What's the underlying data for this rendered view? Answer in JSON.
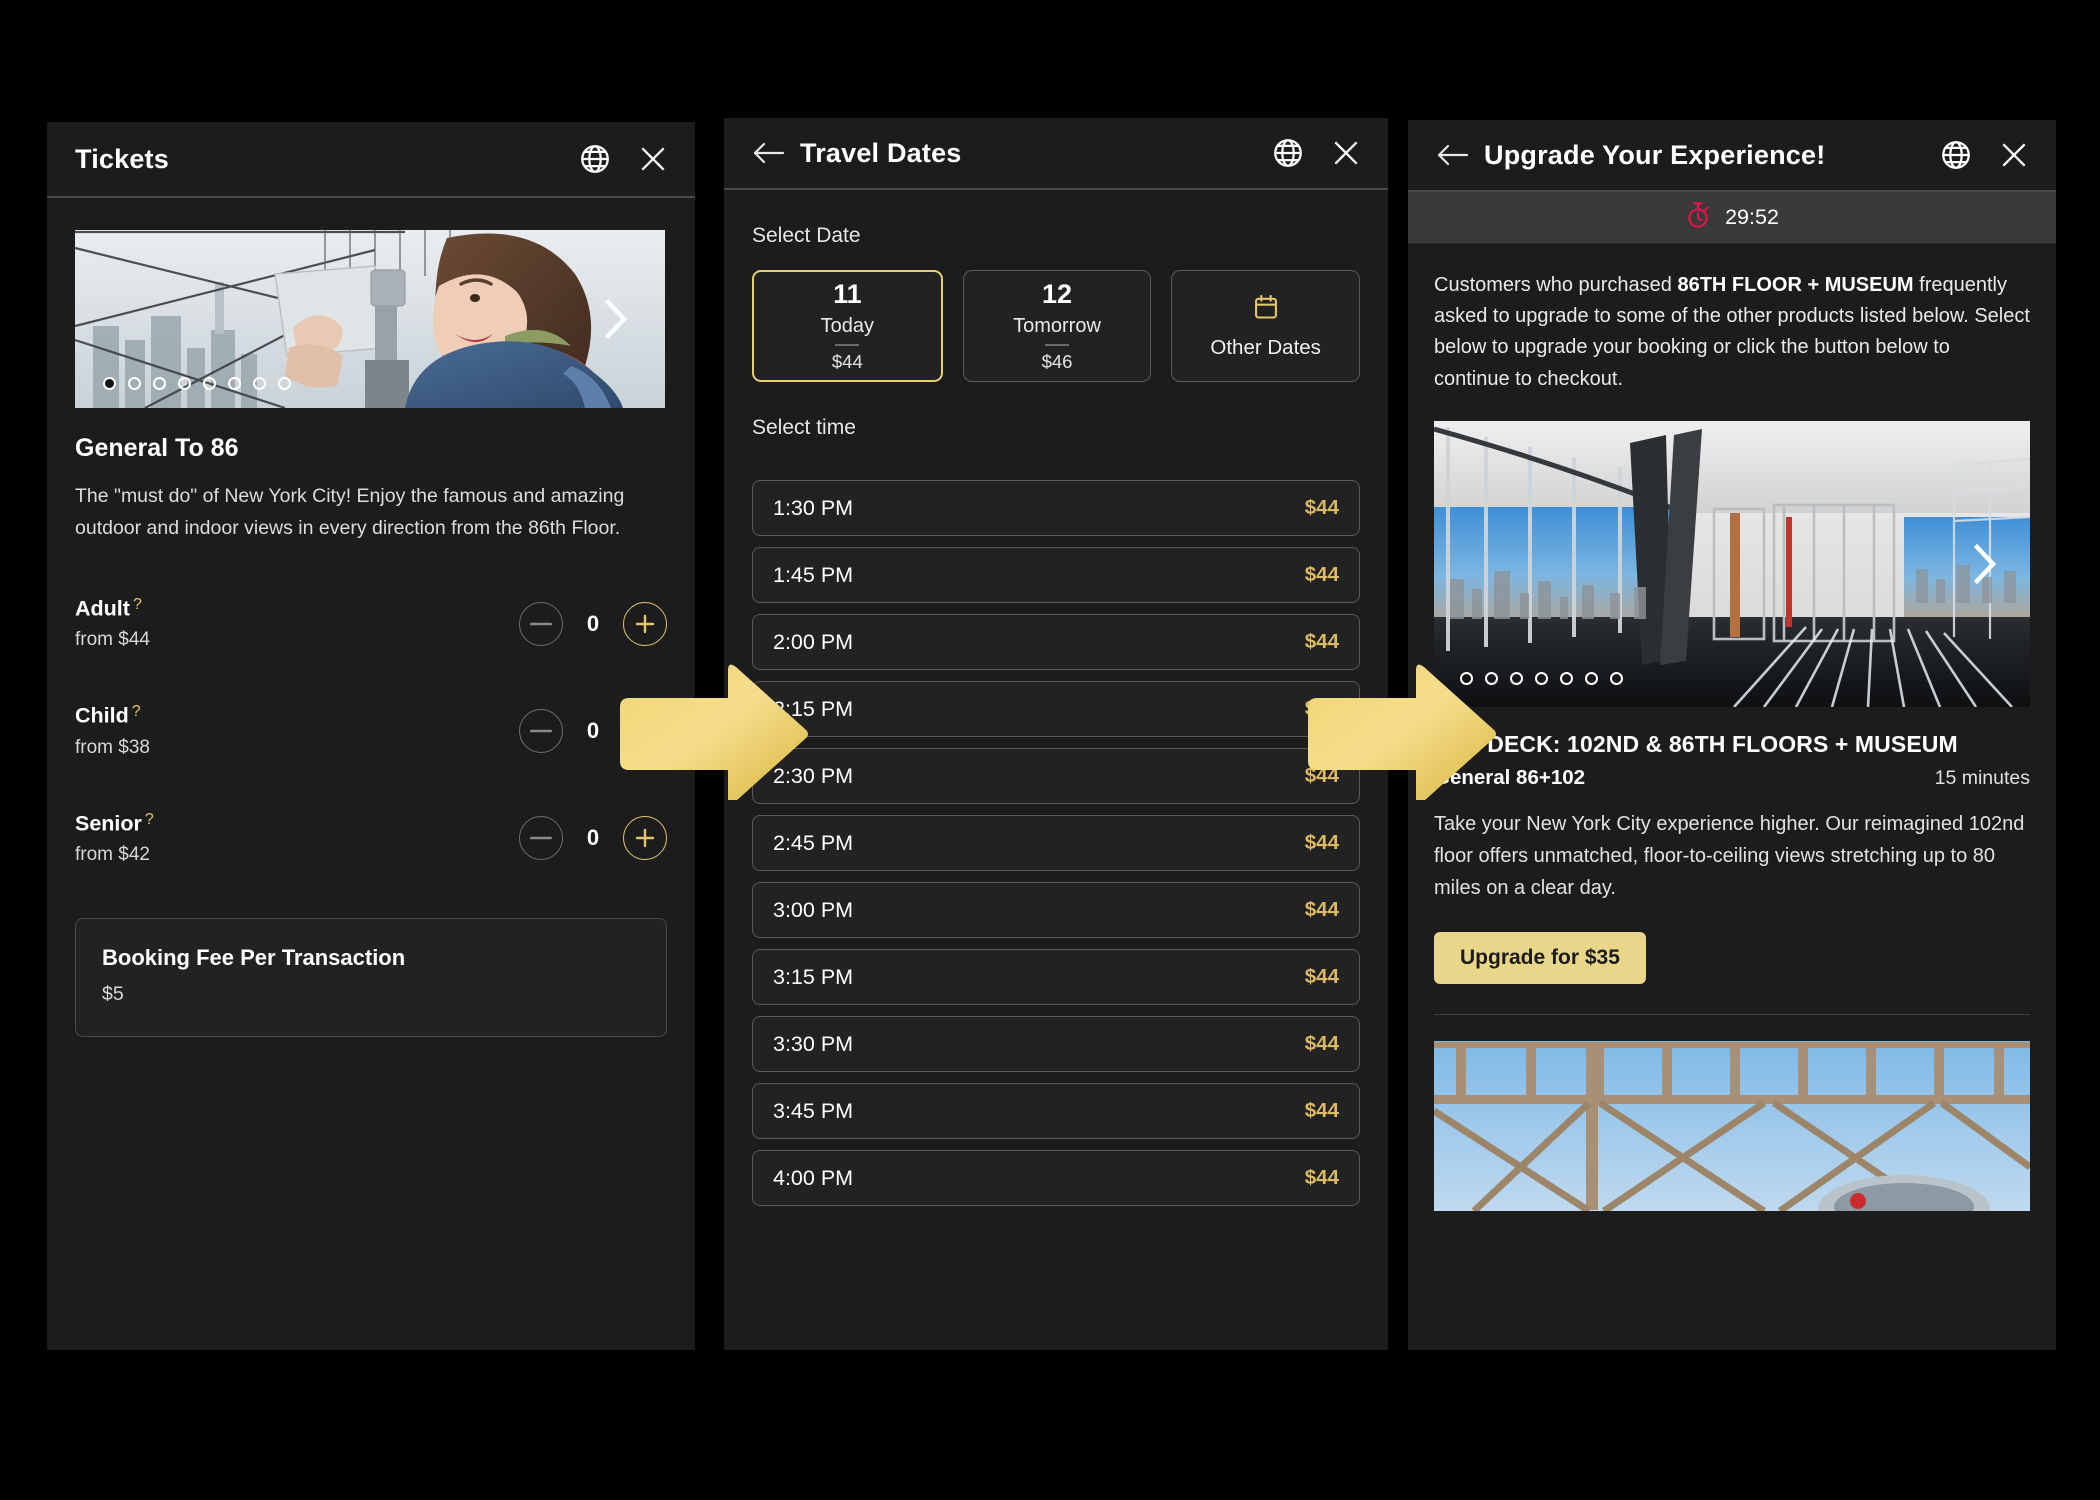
{
  "panels": {
    "tickets": {
      "header": {
        "title": "Tickets",
        "globe_icon": "globe-icon",
        "close_icon": "close-icon"
      },
      "carousel": {
        "dots_total": 8,
        "active_index": 0,
        "next_icon": "chevron-right-icon"
      },
      "product": {
        "title": "General To 86",
        "description": "The \"must do\" of New York City! Enjoy the famous and amazing outdoor and indoor views in every direction from the 86th Floor."
      },
      "passengers": [
        {
          "label": "Adult",
          "help": "?",
          "from": "from $44",
          "count": "0",
          "minus": "—",
          "plus": "+"
        },
        {
          "label": "Child",
          "help": "?",
          "from": "from $38",
          "count": "0",
          "minus": "—",
          "plus": "+"
        },
        {
          "label": "Senior",
          "help": "?",
          "from": "from $42",
          "count": "0",
          "minus": "—",
          "plus": "+"
        }
      ],
      "fee": {
        "title": "Booking Fee Per Transaction",
        "amount": "$5"
      }
    },
    "dates": {
      "header": {
        "title": "Travel Dates",
        "back_icon": "arrow-left-icon",
        "globe_icon": "globe-icon",
        "close_icon": "close-icon"
      },
      "select_date_label": "Select Date",
      "date_cards": [
        {
          "num": "11",
          "word": "Today",
          "price": "$44",
          "selected": true
        },
        {
          "num": "12",
          "word": "Tomorrow",
          "price": "$46",
          "selected": false
        }
      ],
      "other_dates": {
        "label": "Other Dates",
        "icon": "calendar-icon"
      },
      "select_time_label": "Select time",
      "times": [
        {
          "time": "1:30 PM",
          "price": "$44"
        },
        {
          "time": "1:45 PM",
          "price": "$44"
        },
        {
          "time": "2:00 PM",
          "price": "$44"
        },
        {
          "time": "2:15 PM",
          "price": "$44"
        },
        {
          "time": "2:30 PM",
          "price": "$44"
        },
        {
          "time": "2:45 PM",
          "price": "$44"
        },
        {
          "time": "3:00 PM",
          "price": "$44"
        },
        {
          "time": "3:15 PM",
          "price": "$44"
        },
        {
          "time": "3:30 PM",
          "price": "$44"
        },
        {
          "time": "3:45 PM",
          "price": "$44"
        },
        {
          "time": "4:00 PM",
          "price": "$44"
        }
      ]
    },
    "upgrade": {
      "header": {
        "title": "Upgrade Your Experience!",
        "back_icon": "arrow-left-icon",
        "globe_icon": "globe-icon",
        "close_icon": "close-icon"
      },
      "timer": {
        "icon": "stopwatch-icon",
        "value": "29:52",
        "color": "#e8114b"
      },
      "intro_part1": "Customers who purchased ",
      "intro_bold": "86TH FLOOR + MUSEUM",
      "intro_part2": " frequently asked to upgrade to some of the other products listed below. Select below to upgrade your booking or click the button below to continue to checkout.",
      "carousel": {
        "dots_total": 7,
        "active_index": 0,
        "next_icon": "chevron-right-icon"
      },
      "offer": {
        "name": "TOP DECK: 102ND & 86TH FLOORS + MUSEUM",
        "subtitle": "General 86+102",
        "duration": "15 minutes",
        "description": "Take your New York City experience higher. Our reimagined 102nd floor offers unmatched, floor-to-ceiling views stretching up to 80 miles on a clear day.",
        "button": "Upgrade for $35"
      }
    }
  },
  "flow": {
    "arrow1_name": "flow-arrow-right",
    "arrow2_name": "flow-arrow-right"
  },
  "colors": {
    "accent_gold": "#e8cf72",
    "price_gold": "#ddb964",
    "button_gold": "#e9d68a",
    "timer_red": "#e8114b",
    "panel_bg": "#1c1c1c",
    "card_bg": "#222222",
    "page_bg": "#000000"
  }
}
